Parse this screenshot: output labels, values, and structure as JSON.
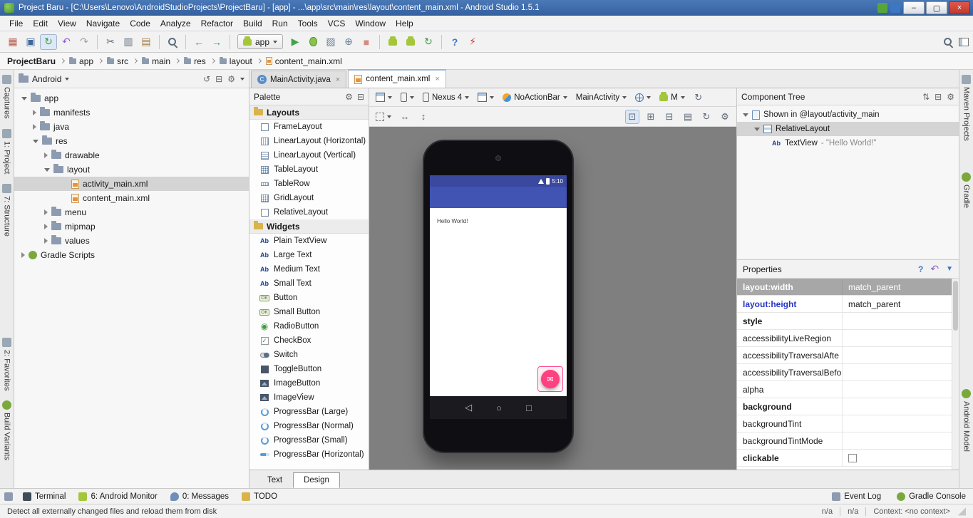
{
  "window": {
    "title": "Project Baru - [C:\\Users\\Lenovo\\AndroidStudioProjects\\ProjectBaru] - [app] - ...\\app\\src\\main\\res\\layout\\content_main.xml - Android Studio 1.5.1",
    "minimize": "–",
    "maximize": "▢",
    "close": "×"
  },
  "menu": {
    "items": [
      "File",
      "Edit",
      "View",
      "Navigate",
      "Code",
      "Analyze",
      "Refactor",
      "Build",
      "Run",
      "Tools",
      "VCS",
      "Window",
      "Help"
    ]
  },
  "toolbar": {
    "run_config": "app",
    "icons": [
      {
        "name": "open",
        "glyph": "▦"
      },
      {
        "name": "save-all",
        "glyph": "▣"
      },
      {
        "name": "sync",
        "glyph": "↻"
      },
      {
        "name": "undo",
        "glyph": "↶"
      },
      {
        "name": "redo",
        "glyph": "↷"
      },
      {
        "name": "cut",
        "glyph": "✂"
      },
      {
        "name": "copy",
        "glyph": "▥"
      },
      {
        "name": "paste",
        "glyph": "▤"
      },
      {
        "name": "back",
        "glyph": "←"
      },
      {
        "name": "forward",
        "glyph": "→"
      },
      {
        "name": "run",
        "glyph": "▶"
      },
      {
        "name": "coverage",
        "glyph": "▨"
      },
      {
        "name": "profiler",
        "glyph": "⊕"
      },
      {
        "name": "stop",
        "glyph": "■"
      },
      {
        "name": "help",
        "glyph": "?"
      },
      {
        "name": "unplug",
        "glyph": "⚡"
      }
    ]
  },
  "breadcrumbs": {
    "items": [
      "ProjectBaru",
      "app",
      "src",
      "main",
      "res",
      "layout",
      "content_main.xml"
    ]
  },
  "left_strip": {
    "items": [
      "Captures",
      "1: Project",
      "7: Structure",
      "2: Favorites",
      "Build Variants"
    ]
  },
  "right_strip": {
    "items": [
      "Maven Projects",
      "Gradle",
      "Android Model"
    ]
  },
  "project": {
    "view": "Android",
    "tree": [
      {
        "label": "app"
      },
      {
        "label": "manifests"
      },
      {
        "label": "java"
      },
      {
        "label": "res"
      },
      {
        "label": "drawable"
      },
      {
        "label": "layout"
      },
      {
        "label": "activity_main.xml"
      },
      {
        "label": "content_main.xml"
      },
      {
        "label": "menu"
      },
      {
        "label": "mipmap"
      },
      {
        "label": "values"
      },
      {
        "label": "Gradle Scripts"
      }
    ]
  },
  "editor": {
    "tabs": [
      {
        "label": "MainActivity.java"
      },
      {
        "label": "content_main.xml"
      }
    ],
    "modes": [
      {
        "label": "Text"
      },
      {
        "label": "Design"
      }
    ]
  },
  "palette": {
    "title": "Palette",
    "groups": [
      {
        "label": "Layouts",
        "items": [
          "FrameLayout",
          "LinearLayout (Horizontal)",
          "LinearLayout (Vertical)",
          "TableLayout",
          "TableRow",
          "GridLayout",
          "RelativeLayout"
        ]
      },
      {
        "label": "Widgets",
        "items": [
          "Plain TextView",
          "Large Text",
          "Medium Text",
          "Small Text",
          "Button",
          "Small Button",
          "RadioButton",
          "CheckBox",
          "Switch",
          "ToggleButton",
          "ImageButton",
          "ImageView",
          "ProgressBar (Large)",
          "ProgressBar (Normal)",
          "ProgressBar (Small)",
          "ProgressBar (Horizontal)"
        ]
      }
    ]
  },
  "design_toolbar": {
    "device": "Nexus 4",
    "theme": "NoActionBar",
    "activity": "MainActivity",
    "api_level": "M"
  },
  "canvas": {
    "phone": {
      "time": "5:10",
      "content_text": "Hello World!",
      "fab_glyph": "✉",
      "nav": {
        "back": "◁",
        "home": "○",
        "recents": "□"
      }
    }
  },
  "component_tree": {
    "title": "Component Tree",
    "items": [
      {
        "label": "Shown in @layout/activity_main"
      },
      {
        "label": "RelativeLayout"
      },
      {
        "label": "TextView",
        "detail": " - \"Hello World!\""
      }
    ]
  },
  "properties": {
    "title": "Properties",
    "rows": [
      {
        "name": "layout:width",
        "value": "match_parent"
      },
      {
        "name": "layout:height",
        "value": "match_parent"
      },
      {
        "name": "style",
        "value": ""
      },
      {
        "name": "accessibilityLiveRegion",
        "value": ""
      },
      {
        "name": "accessibilityTraversalAfte",
        "value": ""
      },
      {
        "name": "accessibilityTraversalBefo",
        "value": ""
      },
      {
        "name": "alpha",
        "value": ""
      },
      {
        "name": "background",
        "value": ""
      },
      {
        "name": "backgroundTint",
        "value": ""
      },
      {
        "name": "backgroundTintMode",
        "value": ""
      },
      {
        "name": "clickable",
        "value": ""
      }
    ]
  },
  "bottom_bar": {
    "left": [
      "Terminal",
      "6: Android Monitor",
      "0: Messages",
      "TODO"
    ],
    "right": [
      "Event Log",
      "Gradle Console"
    ]
  },
  "status_bar": {
    "message": "Detect all externally changed files and reload them from disk",
    "items": [
      "n/a",
      "n/a",
      "Context: <no context>"
    ]
  },
  "icons": {
    "ab": "Ab",
    "ok": "OK",
    "radio": "◉",
    "check": "✓",
    "class_letter": "C",
    "close_tab": "×",
    "gear": "⚙",
    "sort": "⇅",
    "collapse_all": "⊟",
    "refresh": "↺",
    "revert": "↶",
    "filter": "▼",
    "h_arrows": "↔",
    "v_arrows": "↕",
    "square_dot": "⊡",
    "square_plus": "⊞",
    "square_minus": "⊟",
    "doc": "▤",
    "refresh_cw": "↻"
  }
}
